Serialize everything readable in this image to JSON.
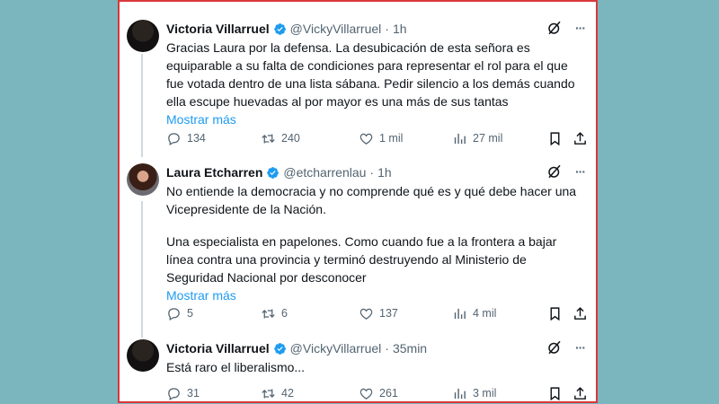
{
  "tweets": [
    {
      "name": "Victoria Villarruel",
      "handle": "@VickyVillarruel",
      "dot": "·",
      "time": "1h",
      "text": "Gracias Laura por la defensa. La desubicación de esta señora es equiparable a su falta de condiciones para representar el rol para el que fue votada dentro de una lista sábana. Pedir silencio a los demás cuando ella escupe huevadas al por mayor es una más de sus tantas",
      "show_more": "Mostrar más",
      "replies": "134",
      "reposts": "240",
      "likes": "1 mil",
      "views": "27 mil"
    },
    {
      "name": "Laura Etcharren",
      "handle": "@etcharrenlau",
      "dot": "·",
      "time": "1h",
      "text1": "No entiende la democracia y no comprende qué es y qué debe hacer una Vicepresidente de la Nación.",
      "text2": "Una especialista en papelones. Como cuando fue a la frontera a bajar línea contra una provincia y terminó destruyendo al Ministerio de Seguridad Nacional por desconocer",
      "show_more": "Mostrar más",
      "replies": "5",
      "reposts": "6",
      "likes": "137",
      "views": "4 mil"
    },
    {
      "name": "Victoria Villarruel",
      "handle": "@VickyVillarruel",
      "dot": "·",
      "time": "35min",
      "text": "Está raro el liberalismo...",
      "replies": "31",
      "reposts": "42",
      "likes": "261",
      "views": "3 mil"
    }
  ],
  "icons": {
    "verified": "verified-badge-icon",
    "grok": "grok-icon",
    "more": "more-options-icon",
    "reply": "reply-icon",
    "repost": "repost-icon",
    "like": "like-icon",
    "views": "views-icon",
    "bookmark": "bookmark-icon",
    "share": "share-icon"
  },
  "more_glyph": "···",
  "colors": {
    "accent": "#1d9bf0",
    "frame_border": "#d8383a",
    "background": "#7bb6bf"
  }
}
